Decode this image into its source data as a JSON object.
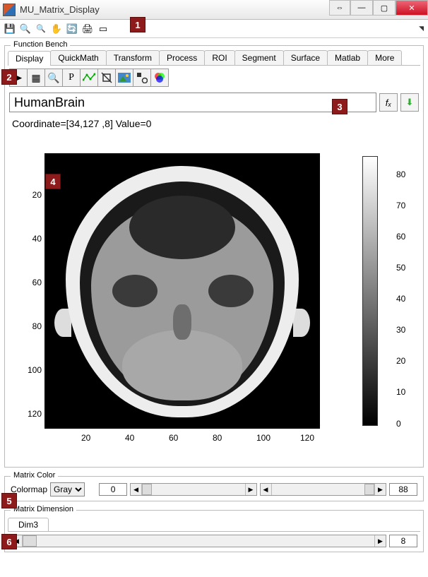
{
  "window": {
    "title": "MU_Matrix_Display"
  },
  "quickbar_icons": [
    "save",
    "zoom-in",
    "zoom-out",
    "pan",
    "rotate",
    "print",
    "new-figure"
  ],
  "function_bench": {
    "legend": "Function Bench",
    "tabs": [
      "Display",
      "QuickMath",
      "Transform",
      "Process",
      "ROI",
      "Segment",
      "Surface",
      "Matlab",
      "More"
    ],
    "active_tab": 0,
    "tool_icons": [
      "pointer",
      "grid",
      "magnifier",
      "P-text",
      "polyline",
      "crop",
      "photo",
      "shapes",
      "rgb-venn"
    ],
    "name_input": "HumanBrain",
    "fx_label": "fₓ",
    "coord_text": "Coordinate=[34,127  ,8] Value=0"
  },
  "plot": {
    "y_ticks": [
      20,
      40,
      60,
      80,
      100,
      120
    ],
    "x_ticks": [
      20,
      40,
      60,
      80,
      100,
      120
    ],
    "colorbar_ticks": [
      0,
      10,
      20,
      30,
      40,
      50,
      60,
      70,
      80
    ]
  },
  "matrix_color": {
    "legend": "Matrix Color",
    "colormap_label": "Colormap",
    "colormap_value": "Gray",
    "min_value": "0",
    "max_value": "88"
  },
  "matrix_dim": {
    "legend": "Matrix Dimension",
    "tab": "Dim3",
    "value": "8"
  },
  "badges": [
    "1",
    "2",
    "3",
    "4",
    "5",
    "6"
  ],
  "chart_data": {
    "type": "heatmap",
    "title": "",
    "xlabel": "",
    "ylabel": "",
    "x_range": [
      1,
      128
    ],
    "y_range": [
      1,
      128
    ],
    "x_ticks": [
      20,
      40,
      60,
      80,
      100,
      120
    ],
    "y_ticks": [
      20,
      40,
      60,
      80,
      100,
      120
    ],
    "colormap": "gray",
    "color_range": [
      0,
      88
    ],
    "colorbar_ticks": [
      0,
      10,
      20,
      30,
      40,
      50,
      60,
      70,
      80
    ],
    "description": "Axial MRI slice (HumanBrain, Dim3 slice 8) rendered as grayscale intensity image",
    "cursor": {
      "coordinate": [
        34,
        127,
        8
      ],
      "value": 0
    }
  }
}
